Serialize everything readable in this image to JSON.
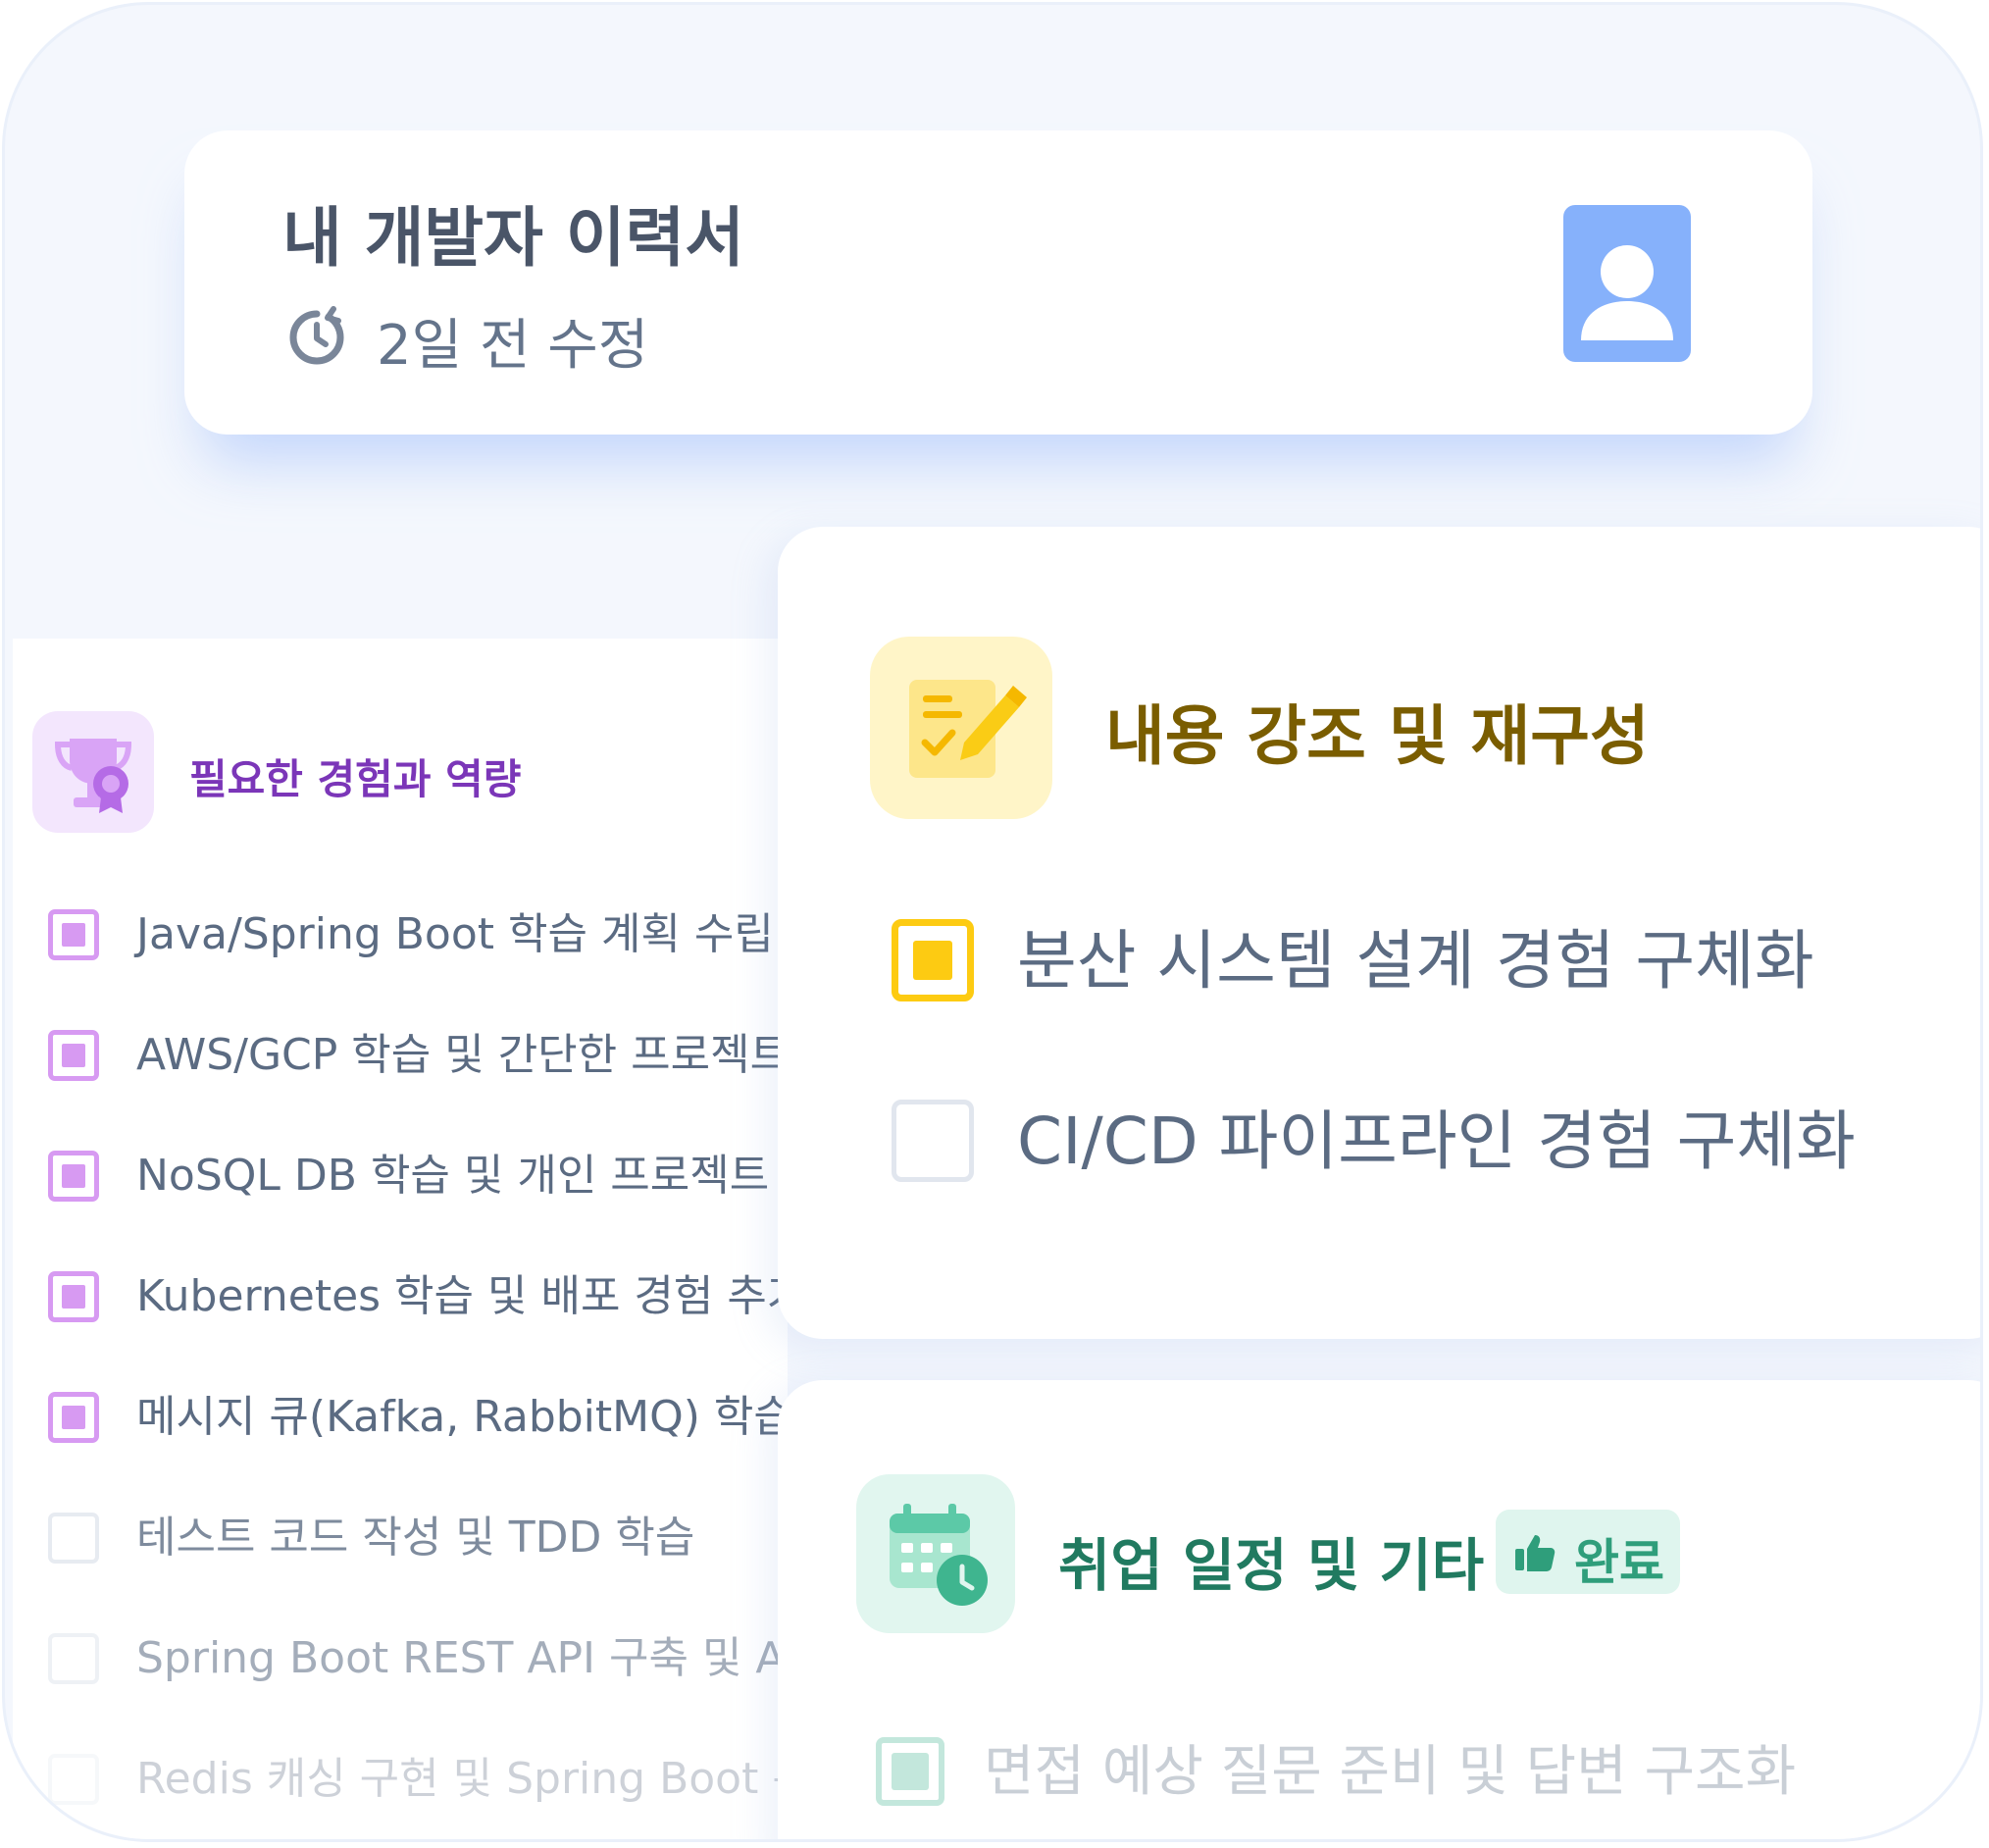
{
  "header": {
    "title": "내 개발자 이력서",
    "modified": "2일 전 수정",
    "icons": {
      "history": "history-icon",
      "profile": "profile-card-icon"
    }
  },
  "left_panel": {
    "title": "필요한 경험과 역량",
    "icon": "trophy-icon",
    "accent_color": "#d79af2",
    "items": [
      {
        "label": "Java/Spring Boot 학습 계획 수립 및",
        "checked": true
      },
      {
        "label": "AWS/GCP 학습 및 간단한 프로젝트 배",
        "checked": true
      },
      {
        "label": "NoSQL DB 학습 및 개인 프로젝트 경험",
        "checked": true
      },
      {
        "label": "Kubernetes 학습 및 배포 경험 추가",
        "checked": true
      },
      {
        "label": "메시지 큐(Kafka, RabbitMQ) 학습 및",
        "checked": true
      },
      {
        "label": "테스트 코드 작성 및 TDD 학습",
        "checked": false
      },
      {
        "label": "Spring Boot REST API 구축 및 AWS",
        "checked": false
      },
      {
        "label": "Redis 캐싱 구현 및 Spring Boot 통합",
        "checked": false
      }
    ]
  },
  "emphasis_panel": {
    "title": "내용 강조 및 재구성",
    "icon": "edit-document-icon",
    "accent_color": "#fdcb12",
    "items": [
      {
        "label": "분산 시스템 설계 경험 구체화",
        "checked": true
      },
      {
        "label": "CI/CD 파이프라인 경험 구체화",
        "checked": false
      }
    ]
  },
  "job_panel": {
    "title": "취업 일정 및 기타",
    "icon": "calendar-clock-icon",
    "badge": "완료",
    "badge_icon": "thumbs-up-icon",
    "accent_color": "#48b894",
    "items": [
      {
        "label": "면접 예상 질문 준비 및 답변 구조화",
        "checked": true
      }
    ]
  }
}
